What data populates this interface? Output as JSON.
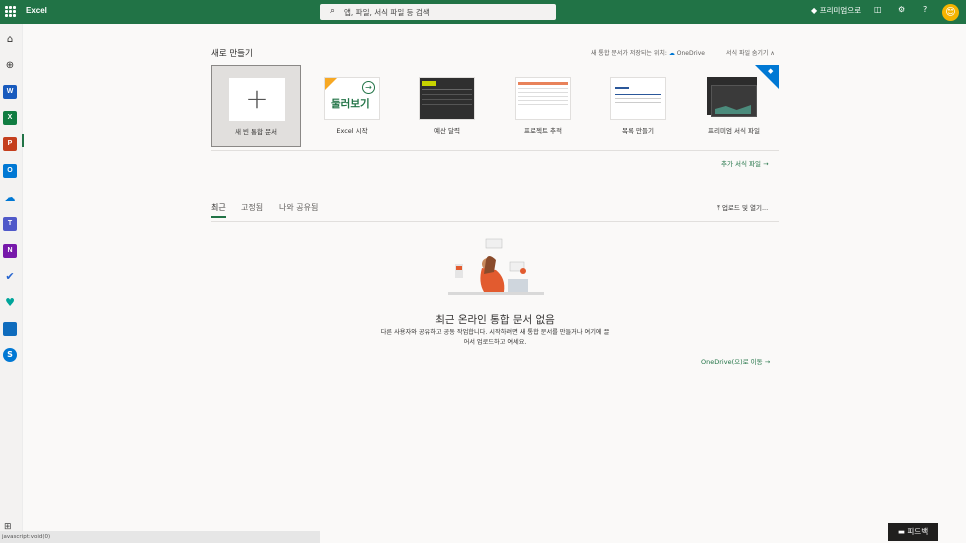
{
  "header": {
    "app_name": "Excel",
    "search_placeholder": "앱, 파일, 서식 파일 등 검색",
    "premium_label": "프리미엄으로",
    "help_label": "?"
  },
  "colors": {
    "brand": "#217346",
    "word": "#185abd",
    "excel": "#107c41",
    "powerpoint": "#c43e1c",
    "outlook": "#0078d4",
    "onenote": "#7719aa",
    "teams": "#5059c9"
  },
  "rail": {
    "icons": [
      "home-icon",
      "create-icon",
      "word-icon",
      "excel-icon",
      "powerpoint-icon",
      "outlook-icon",
      "onedrive-icon",
      "teams-icon",
      "onenote-icon",
      "todo-icon",
      "family-safety-icon",
      "calendar-icon",
      "skype-icon",
      "all-apps-icon"
    ]
  },
  "new_section": {
    "title": "새로 만들기",
    "save_location_label": "새 통합 문서가 저장되는 위치:",
    "save_location_value": "OneDrive",
    "hide_templates": "서식 파일 숨기기 ∧",
    "more_templates": "추가 서식 파일 →",
    "tiles": [
      {
        "label": "새 빈 통합 문서"
      },
      {
        "label": "Excel 시작",
        "thumb_text": "둘러보기"
      },
      {
        "label": "예산 달력"
      },
      {
        "label": "프로젝트 추적"
      },
      {
        "label": "목록 만들기"
      },
      {
        "label": "프리미엄 서식 파일"
      }
    ]
  },
  "recent": {
    "tabs": [
      "최근",
      "고정됨",
      "나와 공유됨"
    ],
    "active_tab": "최근",
    "upload_label": "업로드 및 열기...",
    "empty_title": "최근 온라인 통합 문서 없음",
    "empty_desc_line1": "다른 사용자와 공유하고 공동 작업합니다. 시작하려면 새 통합 문서를 만들거나 여기에 끌",
    "empty_desc_line2": "어서 업로드하고 여세요.",
    "goto_onedrive": "OneDrive(으)로 이동 →"
  },
  "footer": {
    "feedback_label": "피드백",
    "status_text": "javascript:void(0)"
  }
}
